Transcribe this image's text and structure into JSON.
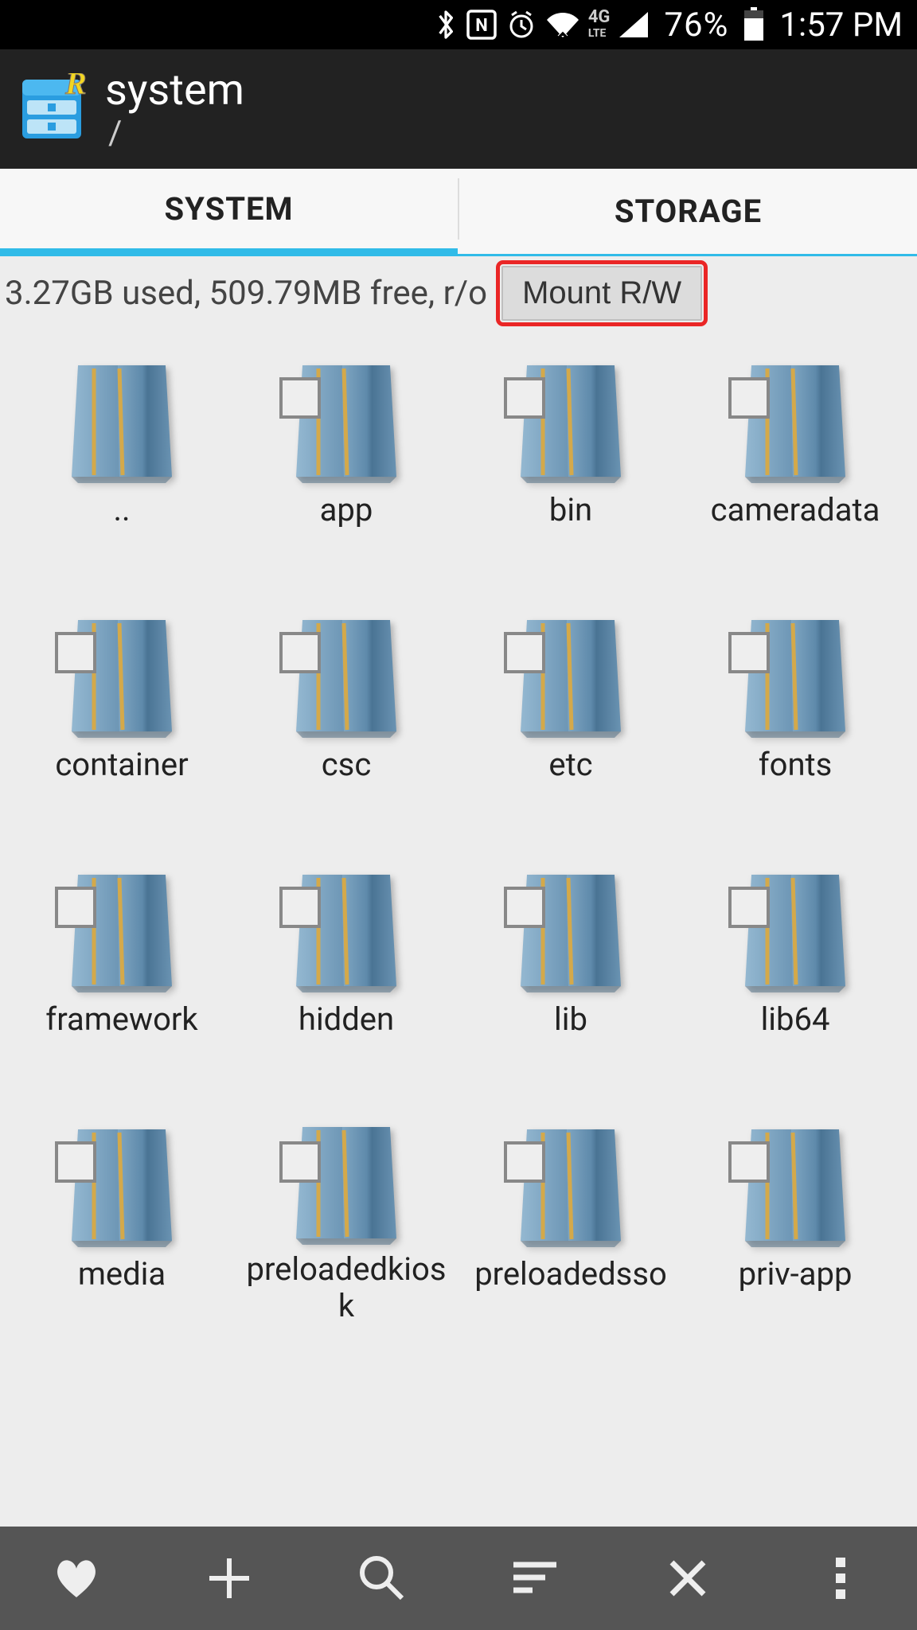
{
  "status_bar": {
    "battery": "76%",
    "time": "1:57 PM",
    "network": "4G"
  },
  "header": {
    "title": "system",
    "path": "/"
  },
  "tabs": [
    {
      "label": "SYSTEM",
      "active": true
    },
    {
      "label": "STORAGE",
      "active": false
    }
  ],
  "status_row": {
    "text": "3.27GB used, 509.79MB free, r/o",
    "button": "Mount R/W"
  },
  "folders": [
    {
      "name": "..",
      "checkbox": false
    },
    {
      "name": "app",
      "checkbox": true
    },
    {
      "name": "bin",
      "checkbox": true
    },
    {
      "name": "cameradata",
      "checkbox": true
    },
    {
      "name": "container",
      "checkbox": true
    },
    {
      "name": "csc",
      "checkbox": true
    },
    {
      "name": "etc",
      "checkbox": true
    },
    {
      "name": "fonts",
      "checkbox": true
    },
    {
      "name": "framework",
      "checkbox": true
    },
    {
      "name": "hidden",
      "checkbox": true
    },
    {
      "name": "lib",
      "checkbox": true
    },
    {
      "name": "lib64",
      "checkbox": true
    },
    {
      "name": "media",
      "checkbox": true
    },
    {
      "name": "preloadedkiosk",
      "checkbox": true
    },
    {
      "name": "preloadedsso",
      "checkbox": true
    },
    {
      "name": "priv-app",
      "checkbox": true
    }
  ],
  "bottom_icons": [
    "heart",
    "plus",
    "search",
    "sort",
    "close",
    "menu"
  ]
}
